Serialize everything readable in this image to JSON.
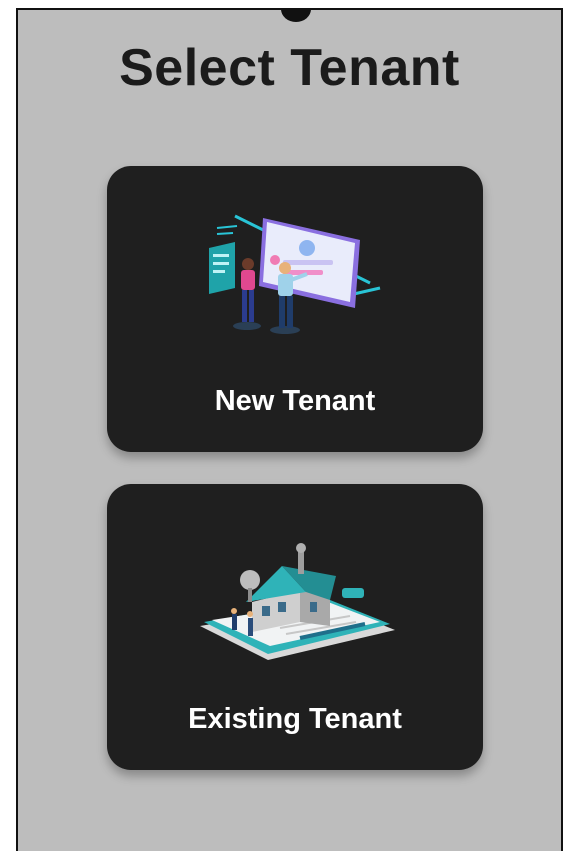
{
  "page": {
    "title": "Select Tenant"
  },
  "options": [
    {
      "label": "New Tenant",
      "icon": "onboarding-illustration-icon"
    },
    {
      "label": "Existing Tenant",
      "icon": "house-on-clipboard-illustration-icon"
    }
  ],
  "colors": {
    "background": "#bdbdbd",
    "card": "#1f1f1f",
    "card_text": "#ffffff",
    "title_text": "#1b1b1b",
    "accent_teal": "#2fb3b8",
    "accent_purple": "#7b5cd6"
  }
}
